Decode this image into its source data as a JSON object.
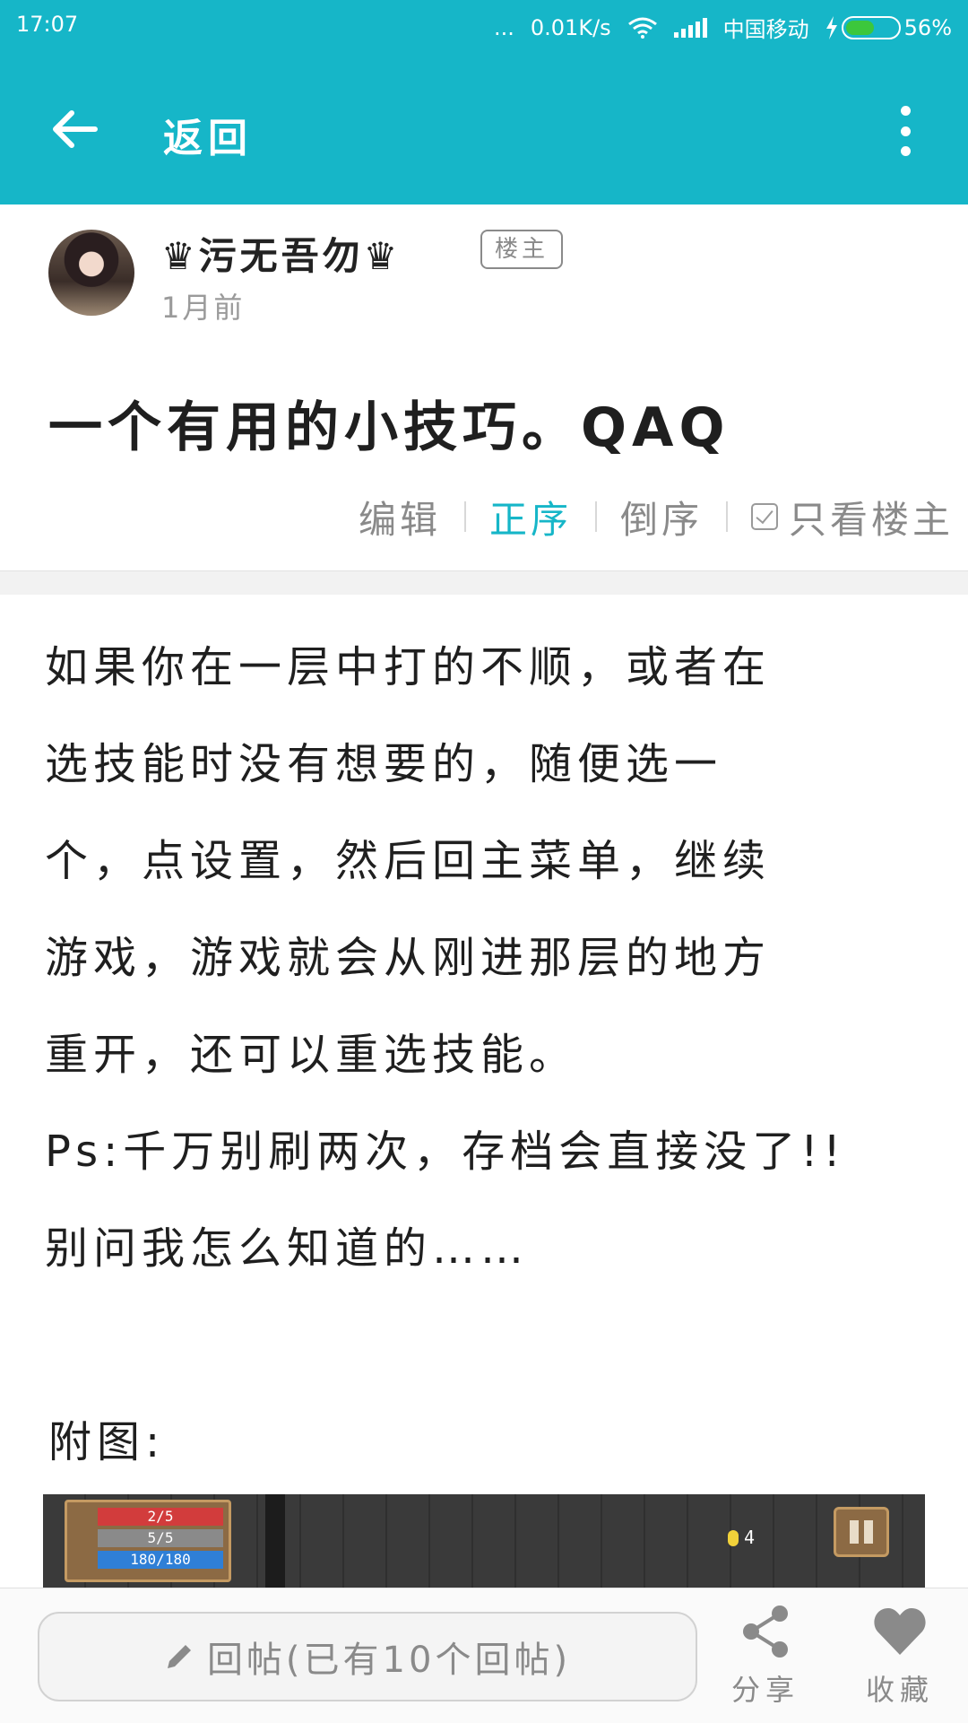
{
  "status_bar": {
    "time": "17:07",
    "dots": "...",
    "speed": "0.01K/s",
    "carrier": "中国移动",
    "battery": "56%"
  },
  "app_bar": {
    "back_label": "返回"
  },
  "post": {
    "author": "♛污无吾勿♛",
    "op_badge": "楼主",
    "time": "1月前",
    "title": "一个有用的小技巧。QAQ"
  },
  "sort": {
    "edit": "编辑",
    "asc": "正序",
    "desc": "倒序",
    "op_only": "只看楼主"
  },
  "content": {
    "lines": [
      "如果你在一层中打的不顺，或者在",
      "选技能时没有想要的，随便选一",
      "个，点设置，然后回主菜单，继续",
      "游戏，游戏就会从刚进那层的地方",
      "重开，还可以重选技能。",
      "Ps:千万别刷两次，存档会直接没了!!",
      "别问我怎么知道的……"
    ],
    "attach_label": "附图:"
  },
  "game_image": {
    "hp": "2/5",
    "armor": "5/5",
    "energy": "180/180",
    "coins": "4"
  },
  "bottom": {
    "reply_placeholder": "回帖(已有10个回帖)",
    "share": "分享",
    "favorite": "收藏"
  },
  "colors": {
    "accent": "#16b6c8",
    "muted": "#8a8a8a"
  }
}
